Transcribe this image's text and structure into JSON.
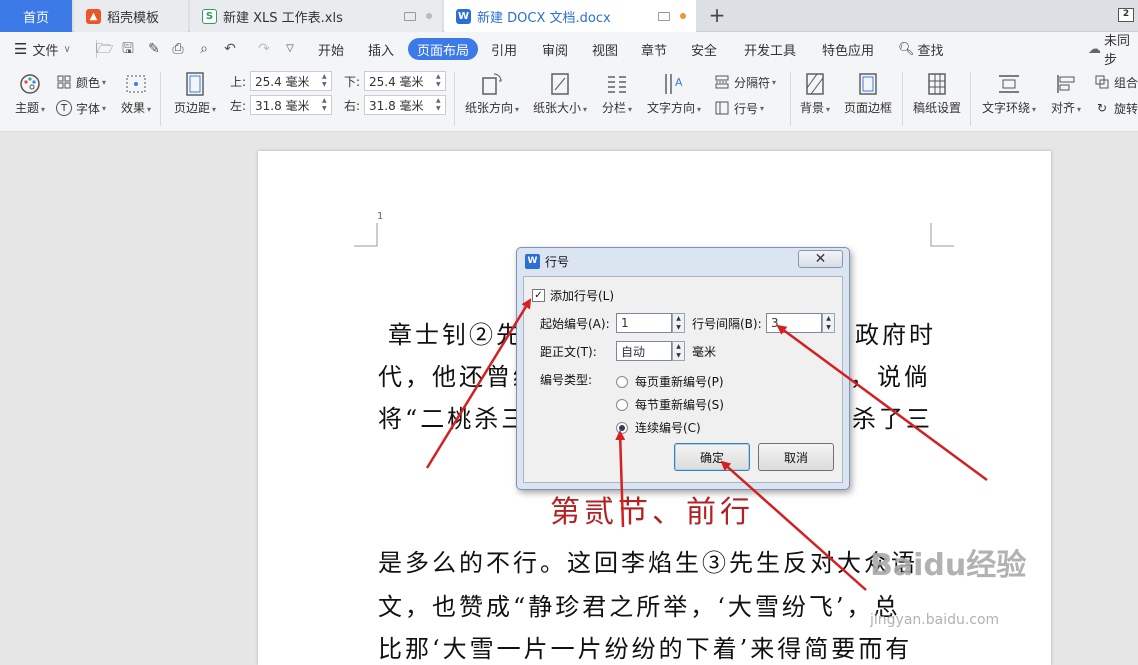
{
  "tabs": {
    "home": "首页",
    "daoke": "稻壳模板",
    "xls": "新建 XLS 工作表.xls",
    "docx": "新建 DOCX 文档.docx",
    "window_count": "2"
  },
  "menu": {
    "file": "文件",
    "items": [
      "开始",
      "插入",
      "页面布局",
      "引用",
      "审阅",
      "视图",
      "章节",
      "安全",
      "开发工具",
      "特色应用"
    ],
    "active": "页面布局",
    "search": "查找",
    "sync": "未同步"
  },
  "ribbon": {
    "theme": "主题",
    "colors": "颜色",
    "fonts": "字体",
    "effects": "效果",
    "margins": "页边距",
    "top_label": "上:",
    "top_value": "25.4 毫米",
    "bottom_label": "下:",
    "bottom_value": "25.4 毫米",
    "left_label": "左:",
    "left_value": "31.8 毫米",
    "right_label": "右:",
    "right_value": "31.8 毫米",
    "orientation": "纸张方向",
    "size": "纸张大小",
    "columns": "分栏",
    "text_direction": "文字方向",
    "breaks": "分隔符",
    "line_numbers": "行号",
    "background": "背景",
    "page_border": "页面边框",
    "manuscript": "稿纸设置",
    "wrap": "文字环绕",
    "align": "对齐",
    "group": "组合",
    "rotate": "旋转"
  },
  "document": {
    "line_number": "1",
    "line1": "章士钊②先",
    "line1_end": "政府时",
    "line2": "代，他还曾经",
    "line2_end": "，说倘",
    "line3": "将“二桃杀三",
    "line3_end": "杀了三",
    "heading": "第贰节、前行",
    "line4": "是多么的不行。这回李焰生③先生反对大众语",
    "line5": "文，也赞成“静珍君之所举，‘大雪纷飞’，总",
    "line6": "比那‘大雪一片一片纷纷的下着’来得简要而有"
  },
  "dialog": {
    "title": "行号",
    "add_line_numbers": "添加行号(L)",
    "add_checked": true,
    "start_label": "起始编号(A):",
    "start_value": "1",
    "interval_label": "行号间隔(B):",
    "interval_value": "3",
    "distance_label": "距正文(T):",
    "distance_value": "自动",
    "distance_unit": "毫米",
    "type_label": "编号类型:",
    "restart_page": "每页重新编号(P)",
    "restart_section": "每节重新编号(S)",
    "continuous": "连续编号(C)",
    "selected": "continuous",
    "ok": "确定",
    "cancel": "取消"
  },
  "watermark": {
    "text": "Baidu经验",
    "url": "jingyan.baidu.com"
  },
  "colors": {
    "accent": "#3c7ae8",
    "arrow": "#d42020",
    "heading": "#b22222"
  }
}
